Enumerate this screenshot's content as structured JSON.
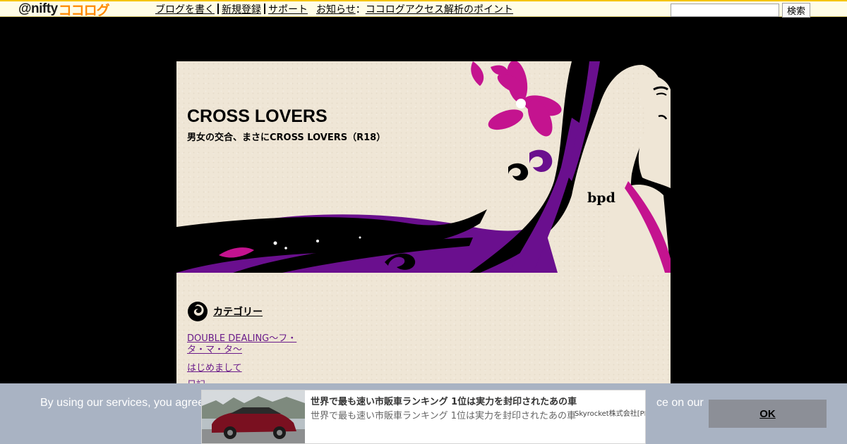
{
  "topbar": {
    "logo_at": "@nifty",
    "logo_kokolog": "ココログ",
    "nav": {
      "write_blog": "ブログを書く",
      "register": "新規登録",
      "support": "サポート",
      "notice_label": "お知らせ",
      "notice_colon": "：",
      "notice_link": "ココログアクセス解析のポイント"
    },
    "search": {
      "value": "",
      "button_label": "検索"
    }
  },
  "blog": {
    "title": "CROSS LOVERS",
    "subtitle": "男女の交合、まさにCROSS LOVERS（R18）",
    "banner_mark": "bpd",
    "category_heading": "カテゴリー",
    "categories": [
      {
        "label": "DOUBLE DEALING～フ・タ・マ・タ～"
      },
      {
        "label": "はじめまして"
      },
      {
        "label": "日記"
      }
    ]
  },
  "cookie_bar": {
    "text": "By using our services, you agree",
    "text_tail": "ce on our",
    "ok_label": "OK"
  },
  "ad": {
    "title": "世界で最も速い市販車ランキング 1位は実力を封印されたあの車",
    "description": "世界で最も速い市販車ランキング 1位は実力を封印されたあの車",
    "sponsor": "Skyrocket株式会社[PR]"
  },
  "colors": {
    "accent_purple": "#6a0f8e",
    "accent_magenta": "#c4138f",
    "topbar_bg": "#fffde6",
    "cookie_bg": "#a9b3c3",
    "ok_bg": "#8c8f97"
  }
}
